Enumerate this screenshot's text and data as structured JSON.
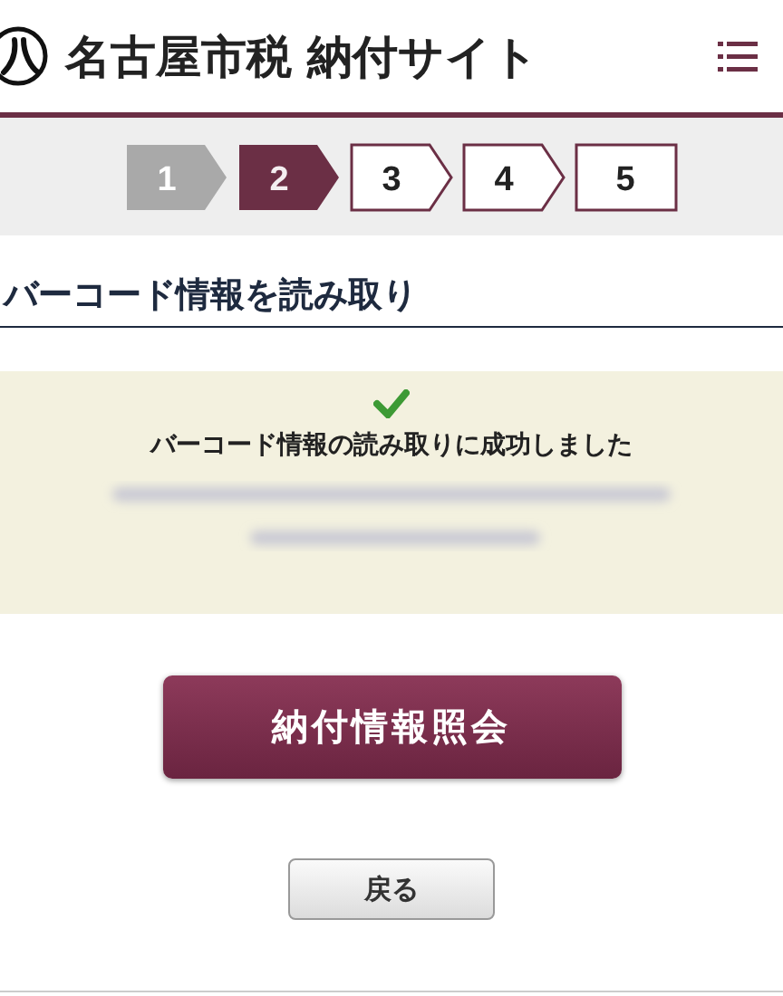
{
  "header": {
    "title": "名古屋市税 納付サイト"
  },
  "steps": [
    {
      "label": "1",
      "done": true,
      "selected": false,
      "kind": "arrow"
    },
    {
      "label": "2",
      "done": false,
      "selected": true,
      "kind": "arrow"
    },
    {
      "label": "3",
      "done": false,
      "selected": false,
      "kind": "arrow"
    },
    {
      "label": "4",
      "done": false,
      "selected": false,
      "kind": "arrow"
    },
    {
      "label": "5",
      "done": false,
      "selected": false,
      "kind": "box"
    }
  ],
  "section": {
    "heading": "バーコード情報を読み取り"
  },
  "notice": {
    "message": "バーコード情報の読み取りに成功しました"
  },
  "buttons": [
    {
      "label": "納付情報照会",
      "kind": "primary"
    },
    {
      "label": "戻る",
      "kind": "secondary"
    }
  ]
}
